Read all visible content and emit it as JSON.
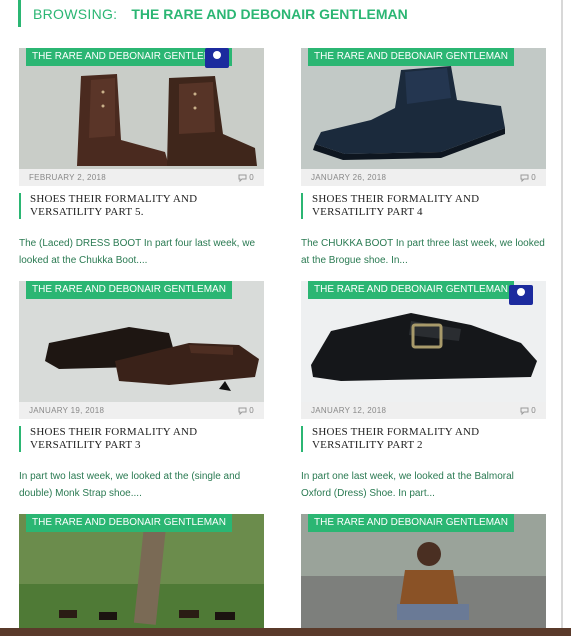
{
  "browsing": {
    "label": "BROWSING:",
    "category": "THE RARE AND DEBONAIR GENTLEMAN"
  },
  "posts": [
    {
      "badge": "THE RARE AND DEBONAIR GENTLEMAN",
      "date": "FEBRUARY 2, 2018",
      "comments": "0",
      "title": "SHOES THEIR FORMALITY AND VERSATILITY PART 5.",
      "excerpt": "The (Laced) DRESS BOOT In part four last week, we looked at the Chukka Boot...."
    },
    {
      "badge": "THE RARE AND DEBONAIR GENTLEMAN",
      "date": "JANUARY 26, 2018",
      "comments": "0",
      "title": "SHOES THEIR FORMALITY AND VERSATILITY PART 4",
      "excerpt": "The CHUKKA BOOT In part three last week, we looked at the Brogue shoe. In..."
    },
    {
      "badge": "THE RARE AND DEBONAIR GENTLEMAN",
      "date": "JANUARY 19, 2018",
      "comments": "0",
      "title": "SHOES THEIR FORMALITY AND VERSATILITY PART 3",
      "excerpt": "In part two last week, we looked at the (single and double) Monk Strap shoe...."
    },
    {
      "badge": "THE RARE AND DEBONAIR GENTLEMAN",
      "date": "JANUARY 12, 2018",
      "comments": "0",
      "title": "SHOES THEIR FORMALITY AND VERSATILITY PART 2",
      "excerpt": "In part one last week, we looked at the Balmoral Oxford (Dress) Shoe. In part..."
    },
    {
      "badge": "THE RARE AND DEBONAIR GENTLEMAN"
    },
    {
      "badge": "THE RARE AND DEBONAIR GENTLEMAN"
    }
  ],
  "colors": {
    "accent": "#2bb673",
    "meta_bg": "#efefef",
    "excerpt": "#2a7a52"
  },
  "icons": {
    "comment": "comment-bubble-icon",
    "logo": "site-logo-icon"
  }
}
